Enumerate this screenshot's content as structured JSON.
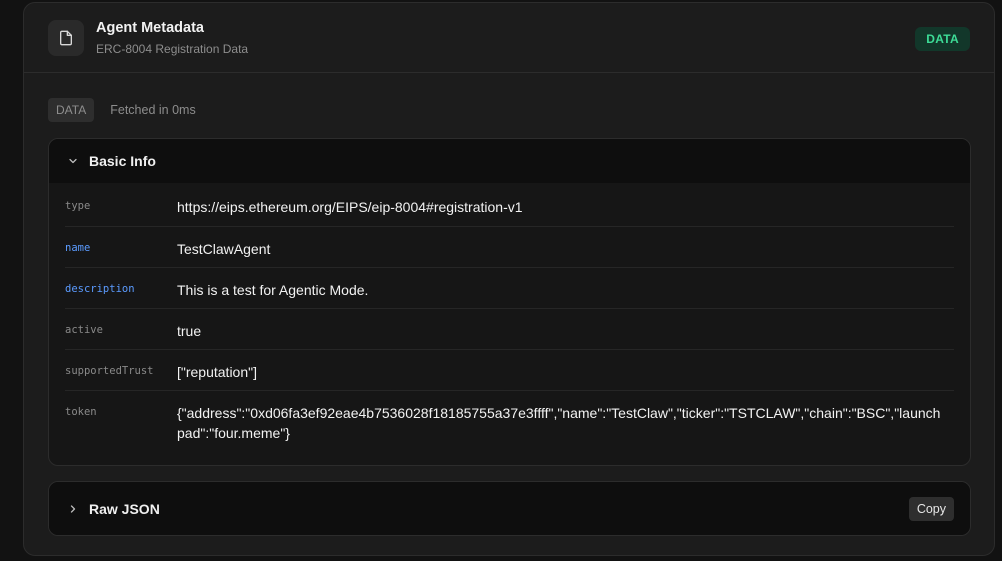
{
  "header": {
    "title": "Agent Metadata",
    "subtitle": "ERC-8004 Registration Data",
    "badge": "DATA",
    "icon": "document-icon"
  },
  "meta": {
    "chip": "DATA",
    "fetched": "Fetched in 0ms"
  },
  "basic_info": {
    "title": "Basic Info",
    "expanded": true,
    "rows": [
      {
        "key": "type",
        "value": "https://eips.ethereum.org/EIPS/eip-8004#registration-v1",
        "key_color": "gray"
      },
      {
        "key": "name",
        "value": "TestClawAgent",
        "key_color": "blue"
      },
      {
        "key": "description",
        "value": "This is a test for Agentic Mode.",
        "key_color": "blue"
      },
      {
        "key": "active",
        "value": "true",
        "key_color": "gray"
      },
      {
        "key": "supportedTrust",
        "value": "[\"reputation\"]",
        "key_color": "gray"
      },
      {
        "key": "token",
        "value": "{\"address\":\"0xd06fa3ef92eae4b7536028f18185755a37e3ffff\",\"name\":\"TestClaw\",\"ticker\":\"TSTCLAW\",\"chain\":\"BSC\",\"launchpad\":\"four.meme\"}",
        "key_color": "gray"
      }
    ]
  },
  "raw_json": {
    "title": "Raw JSON",
    "expanded": false,
    "copy_label": "Copy"
  },
  "colors": {
    "badge_text": "#3ddc97",
    "badge_bg": "#12372a",
    "key_blue": "#5b9bff",
    "key_gray": "#8a8a8a"
  }
}
